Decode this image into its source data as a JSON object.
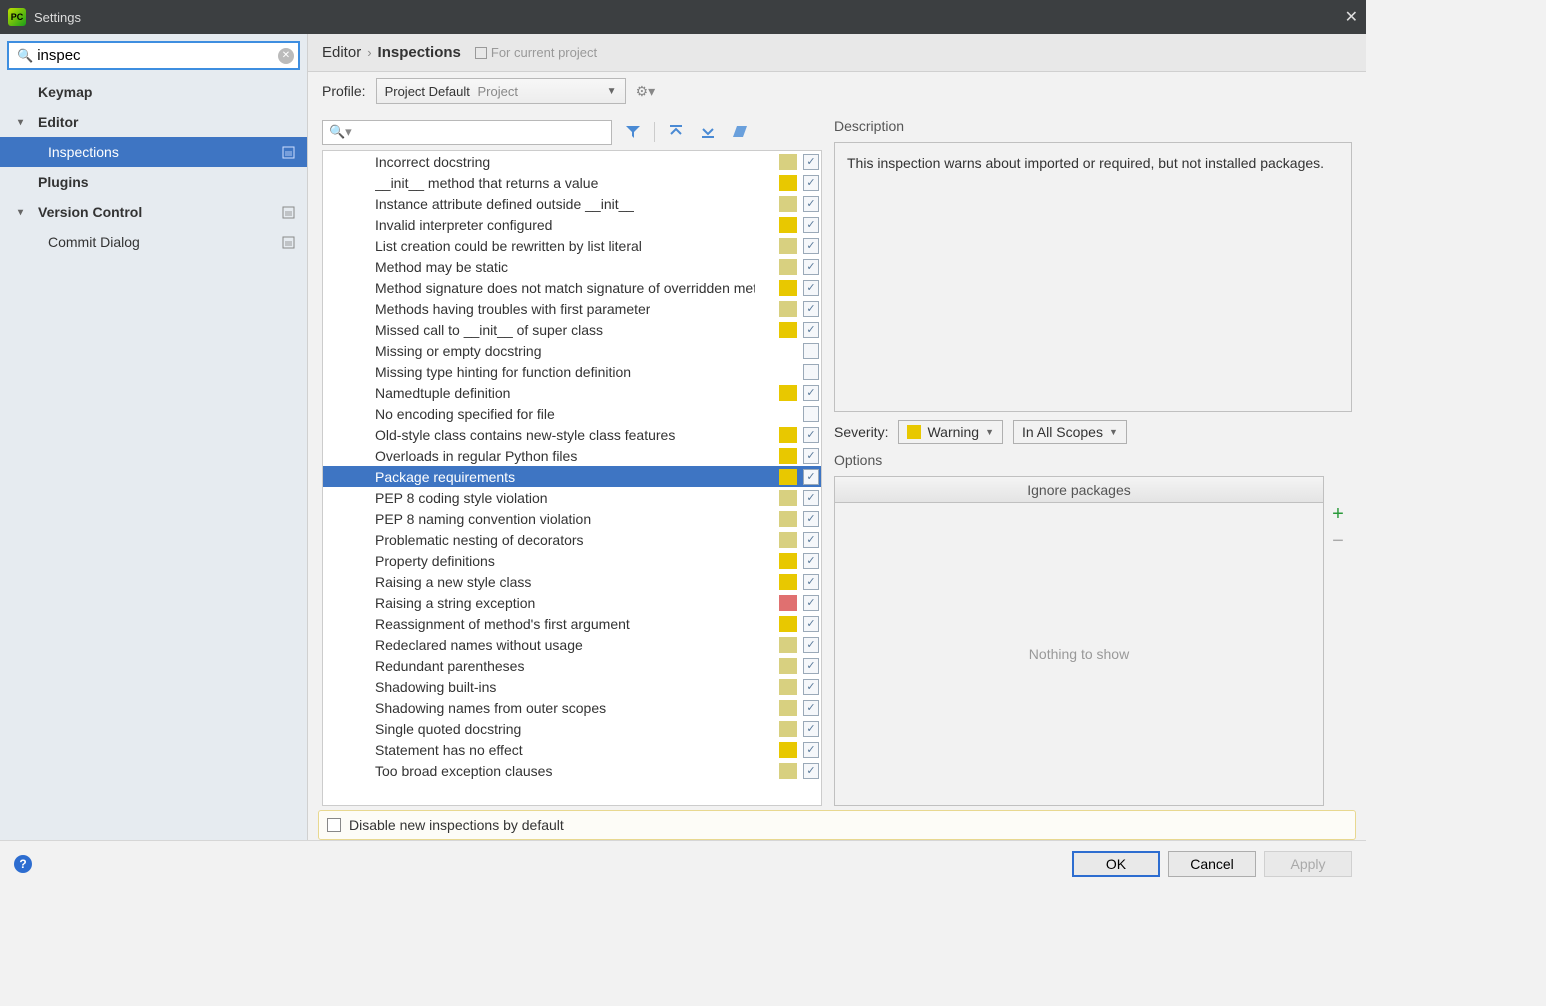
{
  "title": "Settings",
  "search": {
    "value": "inspec"
  },
  "sidebar": {
    "items": [
      {
        "label": "Keymap",
        "level": 1,
        "expander": "",
        "project": false
      },
      {
        "label": "Editor",
        "level": 1,
        "expander": "▾",
        "project": false
      },
      {
        "label": "Inspections",
        "level": 2,
        "expander": "",
        "project": true,
        "selected": true
      },
      {
        "label": "Plugins",
        "level": 1,
        "expander": "",
        "project": false
      },
      {
        "label": "Version Control",
        "level": 1,
        "expander": "▾",
        "project": true
      },
      {
        "label": "Commit Dialog",
        "level": 2,
        "expander": "",
        "project": true
      }
    ]
  },
  "breadcrumb": {
    "parent": "Editor",
    "current": "Inspections",
    "scope": "For current project"
  },
  "profile": {
    "label": "Profile:",
    "name": "Project Default",
    "scope": "Project"
  },
  "insp_search_placeholder": "",
  "inspections": [
    {
      "name": "Incorrect docstring",
      "severity": "weak",
      "checked": true
    },
    {
      "name": "__init__ method that returns a value",
      "severity": "warning",
      "checked": true
    },
    {
      "name": "Instance attribute defined outside __init__",
      "severity": "weak",
      "checked": true
    },
    {
      "name": "Invalid interpreter configured",
      "severity": "warning",
      "checked": true
    },
    {
      "name": "List creation could be rewritten by list literal",
      "severity": "weak",
      "checked": true
    },
    {
      "name": "Method may be static",
      "severity": "weak",
      "checked": true
    },
    {
      "name": "Method signature does not match signature of overridden method",
      "severity": "warning",
      "checked": true
    },
    {
      "name": "Methods having troubles with first parameter",
      "severity": "weak",
      "checked": true
    },
    {
      "name": "Missed call to __init__ of super class",
      "severity": "warning",
      "checked": true
    },
    {
      "name": "Missing or empty docstring",
      "severity": "none",
      "checked": false
    },
    {
      "name": "Missing type hinting for function definition",
      "severity": "none",
      "checked": false
    },
    {
      "name": "Namedtuple definition",
      "severity": "warning",
      "checked": true
    },
    {
      "name": "No encoding specified for file",
      "severity": "none",
      "checked": false
    },
    {
      "name": "Old-style class contains new-style class features",
      "severity": "warning",
      "checked": true
    },
    {
      "name": "Overloads in regular Python files",
      "severity": "warning",
      "checked": true
    },
    {
      "name": "Package requirements",
      "severity": "warning",
      "checked": true,
      "selected": true
    },
    {
      "name": "PEP 8 coding style violation",
      "severity": "weak",
      "checked": true
    },
    {
      "name": "PEP 8 naming convention violation",
      "severity": "weak",
      "checked": true
    },
    {
      "name": "Problematic nesting of decorators",
      "severity": "weak",
      "checked": true
    },
    {
      "name": "Property definitions",
      "severity": "warning",
      "checked": true
    },
    {
      "name": "Raising a new style class",
      "severity": "warning",
      "checked": true
    },
    {
      "name": "Raising a string exception",
      "severity": "error",
      "checked": true
    },
    {
      "name": "Reassignment of method's first argument",
      "severity": "warning",
      "checked": true
    },
    {
      "name": "Redeclared names without usage",
      "severity": "weak",
      "checked": true
    },
    {
      "name": "Redundant parentheses",
      "severity": "weak",
      "checked": true
    },
    {
      "name": "Shadowing built-ins",
      "severity": "weak",
      "checked": true
    },
    {
      "name": "Shadowing names from outer scopes",
      "severity": "weak",
      "checked": true
    },
    {
      "name": "Single quoted docstring",
      "severity": "weak",
      "checked": true
    },
    {
      "name": "Statement has no effect",
      "severity": "warning",
      "checked": true
    },
    {
      "name": "Too broad exception clauses",
      "severity": "weak",
      "checked": true
    }
  ],
  "description": {
    "label": "Description",
    "text": "This inspection warns about imported or required, but not installed packages."
  },
  "severity": {
    "label": "Severity:",
    "value": "Warning",
    "scope": "In All Scopes"
  },
  "options": {
    "label": "Options",
    "header": "Ignore packages",
    "empty": "Nothing to show"
  },
  "disable_row": "Disable new inspections by default",
  "footer": {
    "ok": "OK",
    "cancel": "Cancel",
    "apply": "Apply"
  }
}
